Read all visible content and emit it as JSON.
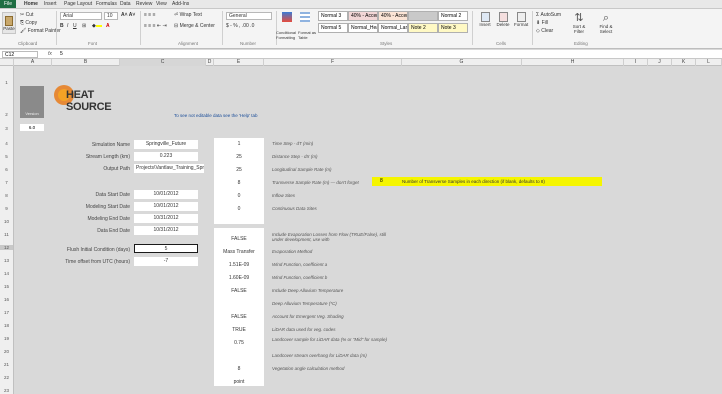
{
  "ribbon": {
    "tabs": [
      "File",
      "Home",
      "Insert",
      "Page Layout",
      "Formulas",
      "Data",
      "Review",
      "View",
      "Add-Ins"
    ],
    "clipboard": {
      "cut": "Cut",
      "copy": "Copy",
      "format_painter": "Format Painter",
      "paste": "Paste",
      "group": "Clipboard"
    },
    "font": {
      "name": "Arial",
      "size": "10",
      "group": "Font"
    },
    "alignment": {
      "wrap": "Wrap Text",
      "merge": "Merge & Center",
      "group": "Alignment"
    },
    "number": {
      "format": "General",
      "symbols": "$ - % , .00 .0",
      "group": "Number"
    },
    "styles": {
      "conditional": "Conditional Formatting",
      "format_table": "Format as Table",
      "cells": [
        "Normal 3",
        "40% - Accent...",
        "40% - Accent...",
        "",
        "Normal 2",
        "Normal 5",
        "Normal_Heat",
        "Normal_Land...",
        "Note 2",
        "Note 3"
      ],
      "group": "Styles"
    },
    "cells_group": {
      "insert": "Insert",
      "delete": "Delete",
      "format": "Format",
      "group": "Cells"
    },
    "editing": {
      "autosum": "AutoSum",
      "fill": "Fill",
      "clear": "Clear",
      "sort": "Sort & Filter",
      "find": "Find & Select",
      "group": "Editing"
    }
  },
  "formula_bar": {
    "name_box": "C12",
    "fx": "fx",
    "content": "5"
  },
  "columns": [
    "A",
    "B",
    "C",
    "D",
    "E",
    "F",
    "G",
    "H",
    "I",
    "J",
    "K",
    "L"
  ],
  "rows": [
    "1",
    "2",
    "3",
    "4",
    "5",
    "6",
    "7",
    "8",
    "9",
    "10",
    "11",
    "12",
    "13",
    "14",
    "15",
    "16",
    "17",
    "18",
    "19",
    "20",
    "21",
    "22",
    "23"
  ],
  "sheet": {
    "logo_text": "HEAT SOURCE",
    "banner_note": "To see not editable data see the 'Help' tab",
    "row2_label": "Version",
    "row3_label": "6.0",
    "left_params": [
      {
        "label": "Simulation Name",
        "value": "Springville_Future"
      },
      {
        "label": "Stream Length (km)",
        "value": "0.223"
      },
      {
        "label": "Output Path",
        "value": "Projects\\Vantlaw_Training_Springville_2012"
      },
      {
        "label": "Data Start Date",
        "value": "10/01/2012"
      },
      {
        "label": "Modeling Start Date",
        "value": "10/01/2012"
      },
      {
        "label": "Modeling End Date",
        "value": "10/31/2012"
      },
      {
        "label": "Data End Date",
        "value": "10/31/2012"
      },
      {
        "label": "Flush Initial Condition (days)",
        "value": "5"
      },
      {
        "label": "Time offset from UTC (hours)",
        "value": "-7"
      }
    ],
    "mid_params": [
      {
        "value": "1",
        "desc": "Time Step - dT (min)"
      },
      {
        "value": "25",
        "desc": "Distance Step - dX (m)"
      },
      {
        "value": "25",
        "desc": "Longitudinal Sample Rate (m)"
      },
      {
        "value": "8",
        "desc": "Transverse Sample Rate (m) — don't forget"
      },
      {
        "value": "0",
        "desc": "Inflow Sites"
      },
      {
        "value": "0",
        "desc": "Continuous Data Sites"
      },
      {
        "value": "FALSE",
        "desc": "Include Evaporation Losses from Flow (TRUE/False), still under development, use with"
      },
      {
        "value": "Mass Transfer",
        "desc": "Evaporation Method"
      },
      {
        "value": "1.51E-09",
        "desc": "Wind Function, coefficient a"
      },
      {
        "value": "1.60E-09",
        "desc": "Wind Function, coefficient b"
      },
      {
        "value": "FALSE",
        "desc": "Include Deep Alluvium Temperature"
      },
      {
        "value": "",
        "desc": "Deep Alluvium Temperature (*C)"
      },
      {
        "value": "FALSE",
        "desc": "Account for Emergent Veg. Shading"
      },
      {
        "value": "TRUE",
        "desc": "LiDAR data used for veg. codes"
      },
      {
        "value": "0.75",
        "desc": "Landcover sample for LiDAR data (% or \"Mid\" for sample)"
      },
      {
        "value": "",
        "desc": "Landcover stream overhang for LiDAR data (m)"
      },
      {
        "value": "8",
        "desc": "Vegetation angle calculation method"
      },
      {
        "value": "point",
        "desc": ""
      }
    ],
    "highlight": {
      "value": "8",
      "text": "Number of Transverse Samples in each direction (if blank, defaults to 8)"
    },
    "colors": {
      "highlight": "#f5f500",
      "logo_orange": "#e8740c",
      "dark_block": "#3a3a3a"
    }
  }
}
